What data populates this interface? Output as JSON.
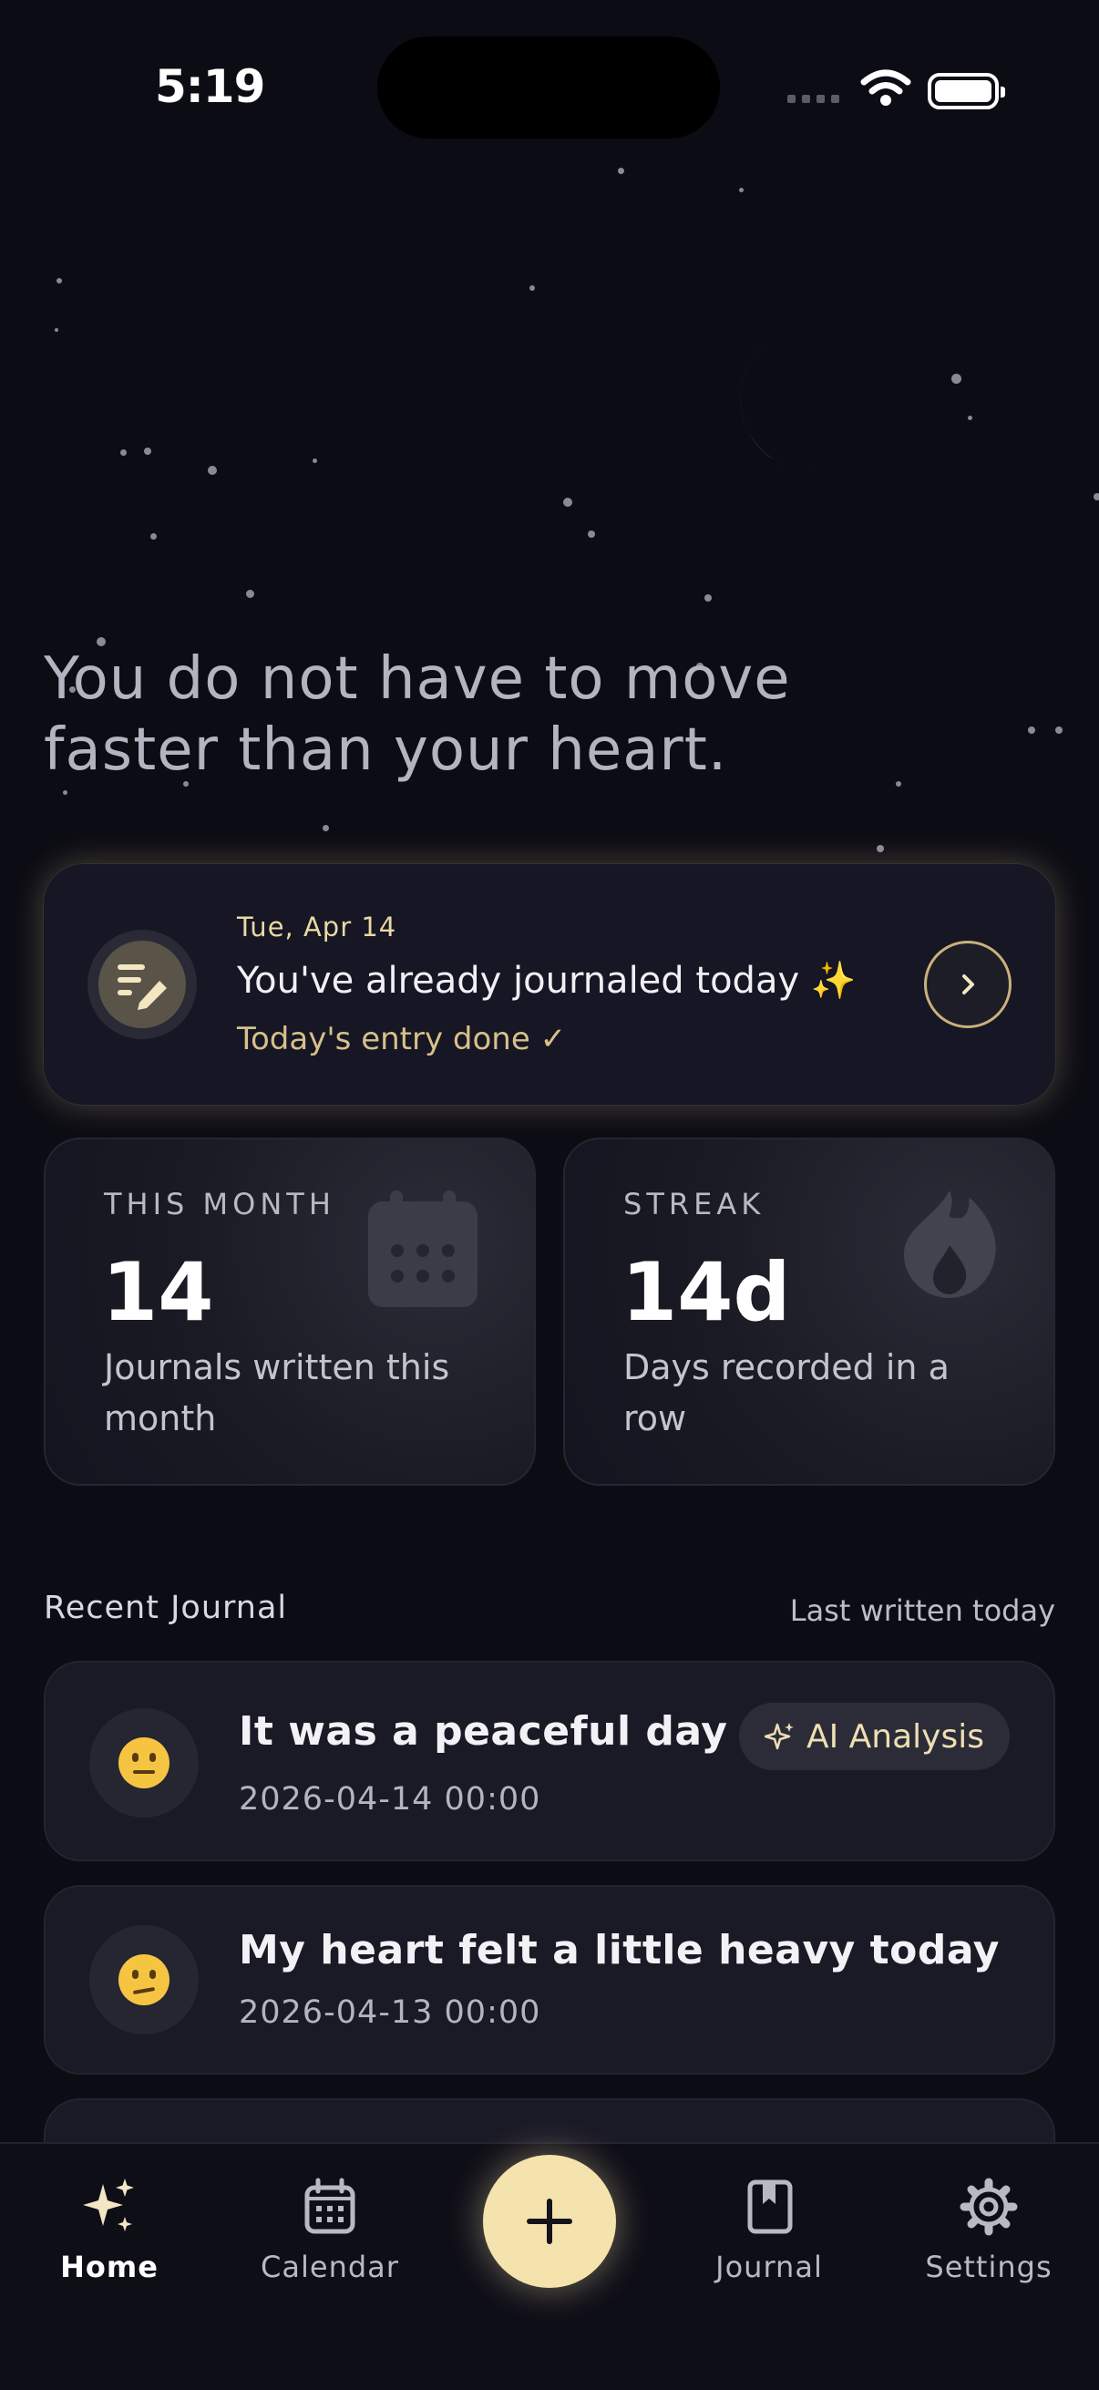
{
  "status_bar": {
    "time": "5:19"
  },
  "quote": "You do not have to move faster than your heart.",
  "today_card": {
    "date": "Tue, Apr 14",
    "message": "You've already journaled today ✨",
    "status": "Today's entry done ✓",
    "icon": "journal-edit-icon",
    "arrow_icon": "chevron-right-icon"
  },
  "stats": [
    {
      "label": "THIS MONTH",
      "value": "14",
      "description": "Journals written this month",
      "icon": "calendar-icon"
    },
    {
      "label": "STREAK",
      "value": "14d",
      "description": "Days recorded in a row",
      "icon": "flame-icon"
    }
  ],
  "recent": {
    "title": "Recent Journal",
    "last_written": "Last written today",
    "entries": [
      {
        "title": "It was a peaceful day",
        "datetime": "2026-04-14 00:00",
        "mood": "neutral-face",
        "badge": "AI Analysis"
      },
      {
        "title": "My heart felt a little heavy today",
        "datetime": "2026-04-13 00:00",
        "mood": "confused-face"
      }
    ]
  },
  "tabbar": {
    "items": [
      {
        "label": "Home",
        "icon": "sparkles-icon",
        "active": true
      },
      {
        "label": "Calendar",
        "icon": "calendar-icon"
      },
      {
        "label": "Journal",
        "icon": "book-icon"
      },
      {
        "label": "Settings",
        "icon": "gear-icon"
      }
    ],
    "fab_icon": "plus-icon"
  },
  "colors": {
    "background": "#0c0c14",
    "accent": "#f5e3ad",
    "card": "#161624"
  }
}
